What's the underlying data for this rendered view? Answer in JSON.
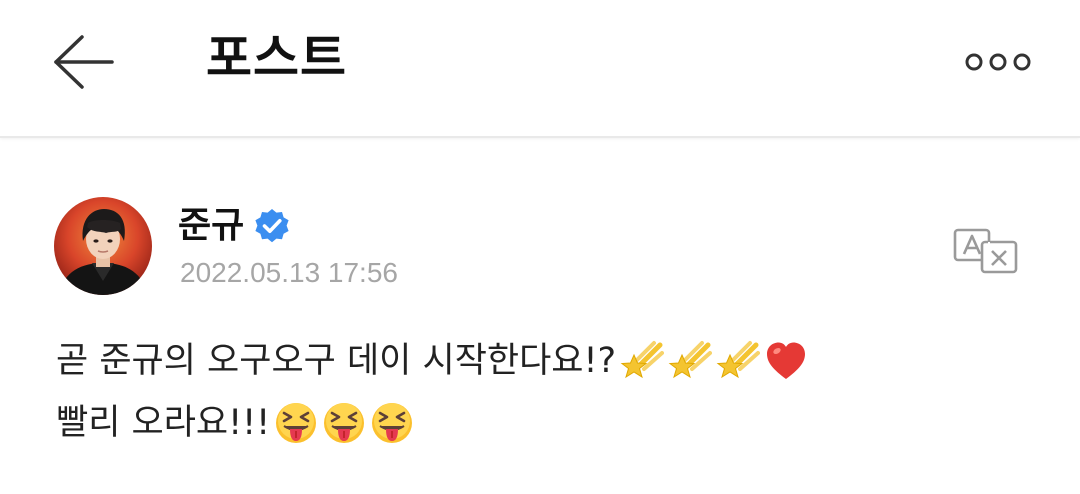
{
  "header": {
    "title": "포스트",
    "back_icon": "arrow-left-icon",
    "more_icon": "more-dots-icon"
  },
  "post": {
    "author": {
      "name": "준규",
      "verified": true,
      "verified_color": "#3b8ef0",
      "avatar": "profile-photo"
    },
    "timestamp": "2022.05.13 17:56",
    "translate_icon": "translate-icon",
    "lines": [
      {
        "text": "곧 준규의 오구오구 데이 시작한다요!?",
        "emojis": [
          "shooting-star-emoji",
          "shooting-star-emoji",
          "shooting-star-emoji",
          "red-heart-emoji"
        ]
      },
      {
        "text": "빨리 오라요!!!",
        "emojis": [
          "squinting-tongue-face-emoji",
          "squinting-tongue-face-emoji",
          "squinting-tongue-face-emoji"
        ]
      }
    ]
  },
  "colors": {
    "text": "#111111",
    "timestamp": "#a6a6a6",
    "divider": "#e9e9e9",
    "verified": "#3b8ef0",
    "heart": "#e53935",
    "star": "#f4c430"
  }
}
